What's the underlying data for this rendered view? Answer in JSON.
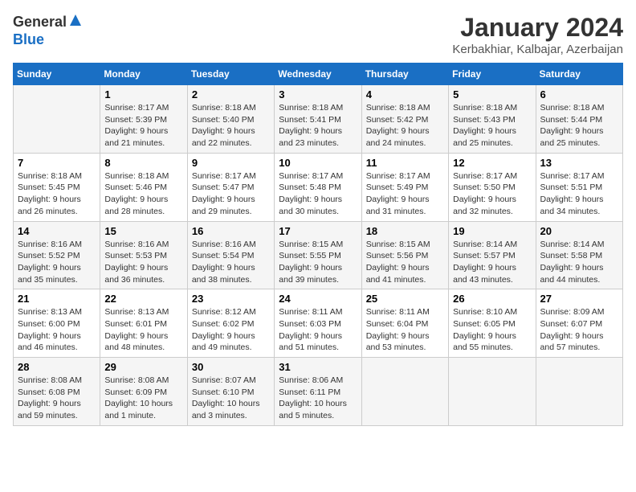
{
  "logo": {
    "general": "General",
    "blue": "Blue"
  },
  "header": {
    "month": "January 2024",
    "location": "Kerbakhiar, Kalbajar, Azerbaijan"
  },
  "weekdays": [
    "Sunday",
    "Monday",
    "Tuesday",
    "Wednesday",
    "Thursday",
    "Friday",
    "Saturday"
  ],
  "weeks": [
    [
      {
        "day": "",
        "sunrise": "",
        "sunset": "",
        "daylight": ""
      },
      {
        "day": "1",
        "sunrise": "Sunrise: 8:17 AM",
        "sunset": "Sunset: 5:39 PM",
        "daylight": "Daylight: 9 hours and 21 minutes."
      },
      {
        "day": "2",
        "sunrise": "Sunrise: 8:18 AM",
        "sunset": "Sunset: 5:40 PM",
        "daylight": "Daylight: 9 hours and 22 minutes."
      },
      {
        "day": "3",
        "sunrise": "Sunrise: 8:18 AM",
        "sunset": "Sunset: 5:41 PM",
        "daylight": "Daylight: 9 hours and 23 minutes."
      },
      {
        "day": "4",
        "sunrise": "Sunrise: 8:18 AM",
        "sunset": "Sunset: 5:42 PM",
        "daylight": "Daylight: 9 hours and 24 minutes."
      },
      {
        "day": "5",
        "sunrise": "Sunrise: 8:18 AM",
        "sunset": "Sunset: 5:43 PM",
        "daylight": "Daylight: 9 hours and 25 minutes."
      },
      {
        "day": "6",
        "sunrise": "Sunrise: 8:18 AM",
        "sunset": "Sunset: 5:44 PM",
        "daylight": "Daylight: 9 hours and 25 minutes."
      }
    ],
    [
      {
        "day": "7",
        "sunrise": "Sunrise: 8:18 AM",
        "sunset": "Sunset: 5:45 PM",
        "daylight": "Daylight: 9 hours and 26 minutes."
      },
      {
        "day": "8",
        "sunrise": "Sunrise: 8:18 AM",
        "sunset": "Sunset: 5:46 PM",
        "daylight": "Daylight: 9 hours and 28 minutes."
      },
      {
        "day": "9",
        "sunrise": "Sunrise: 8:17 AM",
        "sunset": "Sunset: 5:47 PM",
        "daylight": "Daylight: 9 hours and 29 minutes."
      },
      {
        "day": "10",
        "sunrise": "Sunrise: 8:17 AM",
        "sunset": "Sunset: 5:48 PM",
        "daylight": "Daylight: 9 hours and 30 minutes."
      },
      {
        "day": "11",
        "sunrise": "Sunrise: 8:17 AM",
        "sunset": "Sunset: 5:49 PM",
        "daylight": "Daylight: 9 hours and 31 minutes."
      },
      {
        "day": "12",
        "sunrise": "Sunrise: 8:17 AM",
        "sunset": "Sunset: 5:50 PM",
        "daylight": "Daylight: 9 hours and 32 minutes."
      },
      {
        "day": "13",
        "sunrise": "Sunrise: 8:17 AM",
        "sunset": "Sunset: 5:51 PM",
        "daylight": "Daylight: 9 hours and 34 minutes."
      }
    ],
    [
      {
        "day": "14",
        "sunrise": "Sunrise: 8:16 AM",
        "sunset": "Sunset: 5:52 PM",
        "daylight": "Daylight: 9 hours and 35 minutes."
      },
      {
        "day": "15",
        "sunrise": "Sunrise: 8:16 AM",
        "sunset": "Sunset: 5:53 PM",
        "daylight": "Daylight: 9 hours and 36 minutes."
      },
      {
        "day": "16",
        "sunrise": "Sunrise: 8:16 AM",
        "sunset": "Sunset: 5:54 PM",
        "daylight": "Daylight: 9 hours and 38 minutes."
      },
      {
        "day": "17",
        "sunrise": "Sunrise: 8:15 AM",
        "sunset": "Sunset: 5:55 PM",
        "daylight": "Daylight: 9 hours and 39 minutes."
      },
      {
        "day": "18",
        "sunrise": "Sunrise: 8:15 AM",
        "sunset": "Sunset: 5:56 PM",
        "daylight": "Daylight: 9 hours and 41 minutes."
      },
      {
        "day": "19",
        "sunrise": "Sunrise: 8:14 AM",
        "sunset": "Sunset: 5:57 PM",
        "daylight": "Daylight: 9 hours and 43 minutes."
      },
      {
        "day": "20",
        "sunrise": "Sunrise: 8:14 AM",
        "sunset": "Sunset: 5:58 PM",
        "daylight": "Daylight: 9 hours and 44 minutes."
      }
    ],
    [
      {
        "day": "21",
        "sunrise": "Sunrise: 8:13 AM",
        "sunset": "Sunset: 6:00 PM",
        "daylight": "Daylight: 9 hours and 46 minutes."
      },
      {
        "day": "22",
        "sunrise": "Sunrise: 8:13 AM",
        "sunset": "Sunset: 6:01 PM",
        "daylight": "Daylight: 9 hours and 48 minutes."
      },
      {
        "day": "23",
        "sunrise": "Sunrise: 8:12 AM",
        "sunset": "Sunset: 6:02 PM",
        "daylight": "Daylight: 9 hours and 49 minutes."
      },
      {
        "day": "24",
        "sunrise": "Sunrise: 8:11 AM",
        "sunset": "Sunset: 6:03 PM",
        "daylight": "Daylight: 9 hours and 51 minutes."
      },
      {
        "day": "25",
        "sunrise": "Sunrise: 8:11 AM",
        "sunset": "Sunset: 6:04 PM",
        "daylight": "Daylight: 9 hours and 53 minutes."
      },
      {
        "day": "26",
        "sunrise": "Sunrise: 8:10 AM",
        "sunset": "Sunset: 6:05 PM",
        "daylight": "Daylight: 9 hours and 55 minutes."
      },
      {
        "day": "27",
        "sunrise": "Sunrise: 8:09 AM",
        "sunset": "Sunset: 6:07 PM",
        "daylight": "Daylight: 9 hours and 57 minutes."
      }
    ],
    [
      {
        "day": "28",
        "sunrise": "Sunrise: 8:08 AM",
        "sunset": "Sunset: 6:08 PM",
        "daylight": "Daylight: 9 hours and 59 minutes."
      },
      {
        "day": "29",
        "sunrise": "Sunrise: 8:08 AM",
        "sunset": "Sunset: 6:09 PM",
        "daylight": "Daylight: 10 hours and 1 minute."
      },
      {
        "day": "30",
        "sunrise": "Sunrise: 8:07 AM",
        "sunset": "Sunset: 6:10 PM",
        "daylight": "Daylight: 10 hours and 3 minutes."
      },
      {
        "day": "31",
        "sunrise": "Sunrise: 8:06 AM",
        "sunset": "Sunset: 6:11 PM",
        "daylight": "Daylight: 10 hours and 5 minutes."
      },
      {
        "day": "",
        "sunrise": "",
        "sunset": "",
        "daylight": ""
      },
      {
        "day": "",
        "sunrise": "",
        "sunset": "",
        "daylight": ""
      },
      {
        "day": "",
        "sunrise": "",
        "sunset": "",
        "daylight": ""
      }
    ]
  ]
}
